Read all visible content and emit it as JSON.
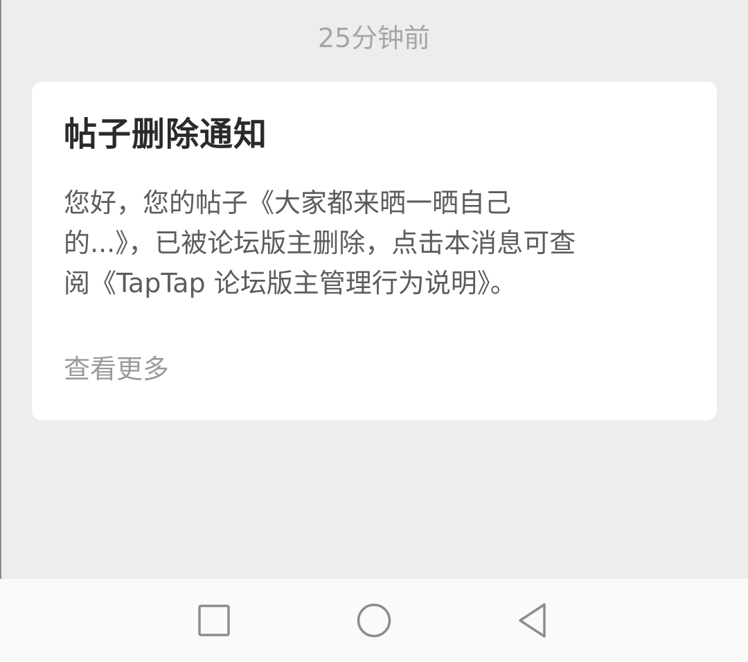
{
  "message": {
    "timestamp": "25分钟前",
    "title": "帖子删除通知",
    "body_line1": "您好，您的帖子《大家都来晒一晒自己",
    "body_line2": "的...》，已被论坛版主删除，点击本消息可查",
    "body_line3": "阅《TapTap 论坛版主管理行为说明》。",
    "see_more_label": "查看更多"
  },
  "navbar": {
    "icons": [
      "recents-square-icon",
      "home-circle-icon",
      "back-triangle-icon"
    ]
  },
  "colors": {
    "background": "#ededed",
    "card": "#ffffff",
    "title": "#2a2a2a",
    "body": "#5c5c5c",
    "muted": "#9a9a9a",
    "nav_icon": "#8c8c8c"
  }
}
